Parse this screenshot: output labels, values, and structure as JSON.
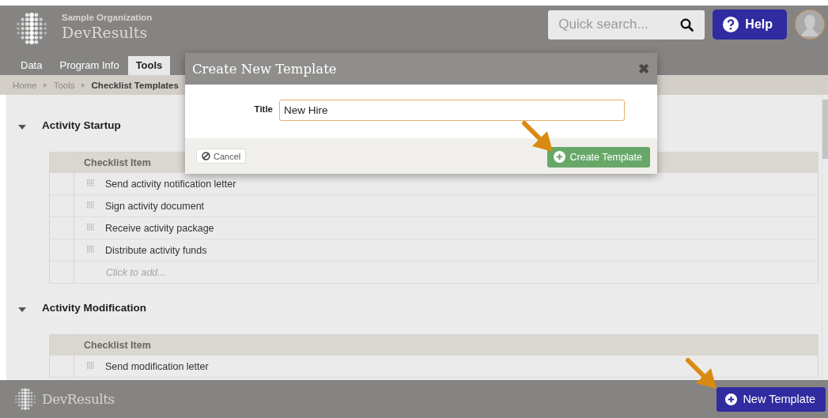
{
  "header": {
    "organization": "Sample Organization",
    "app_name": "DevResults",
    "search": {
      "placeholder": "Quick search..."
    },
    "help_button": "Help"
  },
  "nav_tabs": [
    {
      "label": "Data",
      "selected": false
    },
    {
      "label": "Program Info",
      "selected": false
    },
    {
      "label": "Tools",
      "selected": true
    }
  ],
  "breadcrumb": [
    {
      "label": "Home",
      "current": false
    },
    {
      "label": "Tools",
      "current": false
    },
    {
      "label": "Checklist Templates",
      "current": true
    }
  ],
  "sections": [
    {
      "title": "Activity Startup",
      "expanded": true,
      "column": "Checklist Item",
      "items": [
        "Send activity notification letter",
        "Sign activity document",
        "Receive activity package",
        "Distribute activity funds"
      ],
      "add_placeholder": "Click to add..."
    },
    {
      "title": "Activity Modification",
      "expanded": true,
      "column": "Checklist Item",
      "items": [
        "Send modification letter"
      ]
    }
  ],
  "dialog": {
    "title": "Create New Template",
    "close": "✖",
    "field_label": "Title",
    "field_value": "New Hire",
    "cancel_button": "Cancel",
    "create_button": "Create Template"
  },
  "footer": {
    "app_name": "DevResults",
    "new_button": "New Template"
  }
}
